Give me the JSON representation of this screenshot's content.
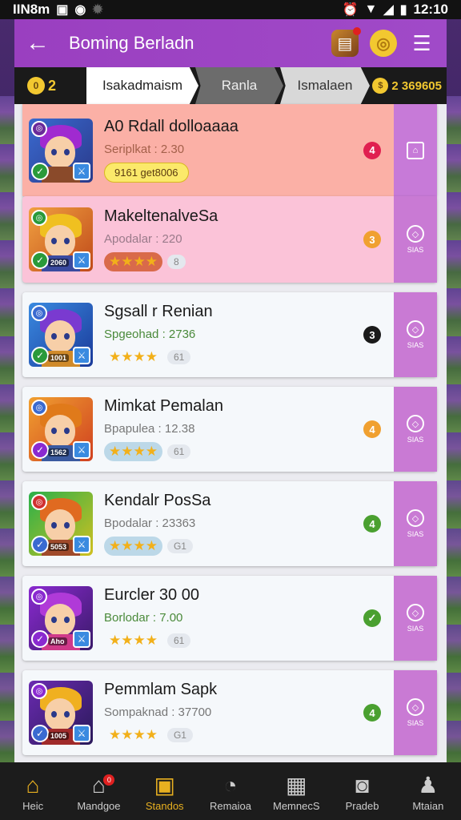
{
  "status_bar": {
    "carrier": "IIN8m",
    "time": "12:10"
  },
  "header": {
    "title": "Boming Berladn"
  },
  "tabs": {
    "left_coins": "2",
    "items": [
      {
        "label": "Isakadmaism"
      },
      {
        "label": "Ranla"
      },
      {
        "label": "Ismalaen"
      }
    ],
    "right_coins": "2 369605"
  },
  "players": [
    {
      "name": "A0 Rdall dolloaaaa",
      "sub": "Seriplkat : 2.30",
      "chip": "9161 get8006",
      "rank": "4",
      "rank_color": "#e02050",
      "action_label": ""
    },
    {
      "name": "MakeltenalveSa",
      "sub": "Apodalar : 220",
      "stars_count": "8",
      "mini_label": "2060",
      "rank": "3",
      "rank_color": "#f0a030",
      "action_label": "SIAS"
    },
    {
      "name": "Sgsall r Renian",
      "sub": "Spgeohad : 2736",
      "stars_count": "61",
      "mini_label": "1001",
      "rank": "3",
      "rank_color": "#1a1a1a",
      "action_label": "SIAS"
    },
    {
      "name": "Mimkat Pemalan",
      "sub": "Bpapulea : 12.38",
      "stars_count": "61",
      "mini_label": "1562",
      "rank": "4",
      "rank_color": "#f0a030",
      "action_label": "SIAS"
    },
    {
      "name": "Kendalr PosSa",
      "sub": "Bpodalar : 23363",
      "stars_count": "G1",
      "mini_label": "5053",
      "rank": "4",
      "rank_color": "#4aa030",
      "action_label": "SIAS"
    },
    {
      "name": "Eurcler 30 00",
      "sub": "Borlodar : 7.00",
      "stars_count": "61",
      "mini_label": "Aho",
      "rank": "✓",
      "rank_color": "#4aa030",
      "action_label": "SIAS"
    },
    {
      "name": "Pemmlam Sapk",
      "sub": "Sompaknad : 37700",
      "stars_count": "G1",
      "mini_label": "1005",
      "rank": "4",
      "rank_color": "#4aa030",
      "action_label": "SIAS"
    }
  ],
  "bottom_nav": [
    {
      "label": "Heic",
      "icon": "home-icon"
    },
    {
      "label": "Mandgoe",
      "icon": "house-notification-icon",
      "badge": "0"
    },
    {
      "label": "Standos",
      "icon": "briefcase-icon"
    },
    {
      "label": "Remaioa",
      "icon": "clock-icon"
    },
    {
      "label": "MemnecS",
      "icon": "image-icon"
    },
    {
      "label": "Pradeb",
      "icon": "camera-icon"
    },
    {
      "label": "Mtaian",
      "icon": "person-icon"
    }
  ],
  "colors": {
    "header_purple": "#9a3fc0",
    "side_action_purple": "#c97ad4",
    "active_nav": "#e8b020"
  }
}
